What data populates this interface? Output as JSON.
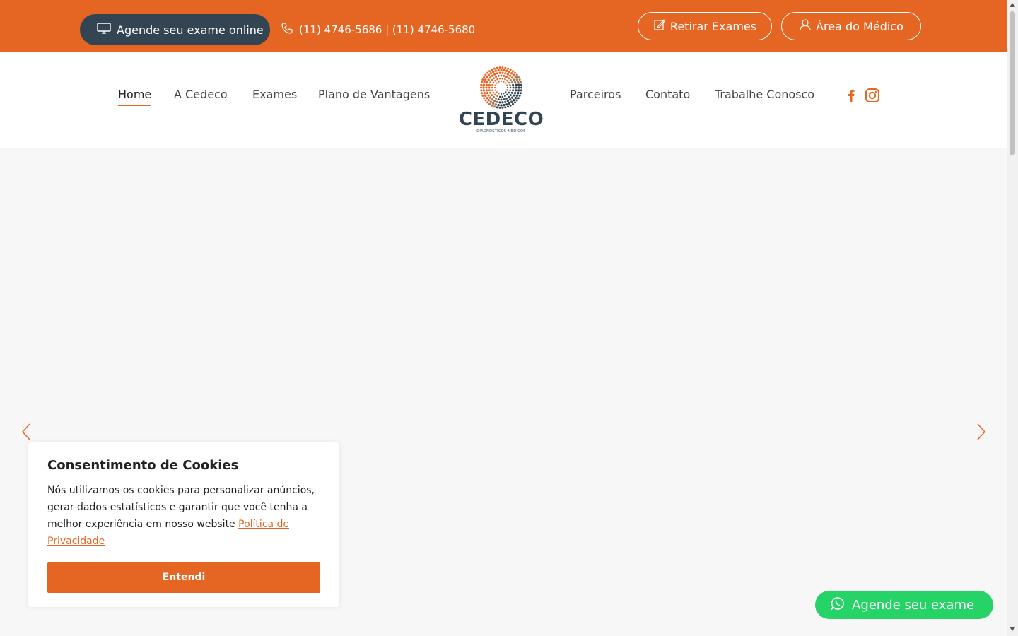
{
  "topbar": {
    "online_label": "Agende seu exame online",
    "phone": "(11) 4746-5686 | (11) 4746-5680",
    "retirar_label": "Retirar Exames",
    "medico_label": "Área do Médico"
  },
  "nav": {
    "left": [
      {
        "label": "Home"
      },
      {
        "label": "A Cedeco"
      },
      {
        "label": "Exames"
      },
      {
        "label": "Plano de Vantagens"
      }
    ],
    "right": [
      {
        "label": "Parceiros"
      },
      {
        "label": "Contato"
      },
      {
        "label": "Trabalhe Conosco"
      }
    ],
    "social": [
      "facebook-icon",
      "instagram-icon"
    ]
  },
  "logo": {
    "word": "CEDECO",
    "sub": "DIAGNÓSTICOS MÉDICOS"
  },
  "cookie": {
    "title": "Consentimento de Cookies",
    "text": "Nós utilizamos os cookies para personalizar anúncios, gerar dados estatísticos e garantir que você tenha a melhor experiência em nosso website ",
    "link": "Política de Privacidade",
    "button": "Entendi"
  },
  "whatsapp": {
    "label": "Agende seu exame"
  },
  "colors": {
    "accent": "#e56623",
    "dark": "#334552",
    "whatsapp": "#25d366"
  }
}
